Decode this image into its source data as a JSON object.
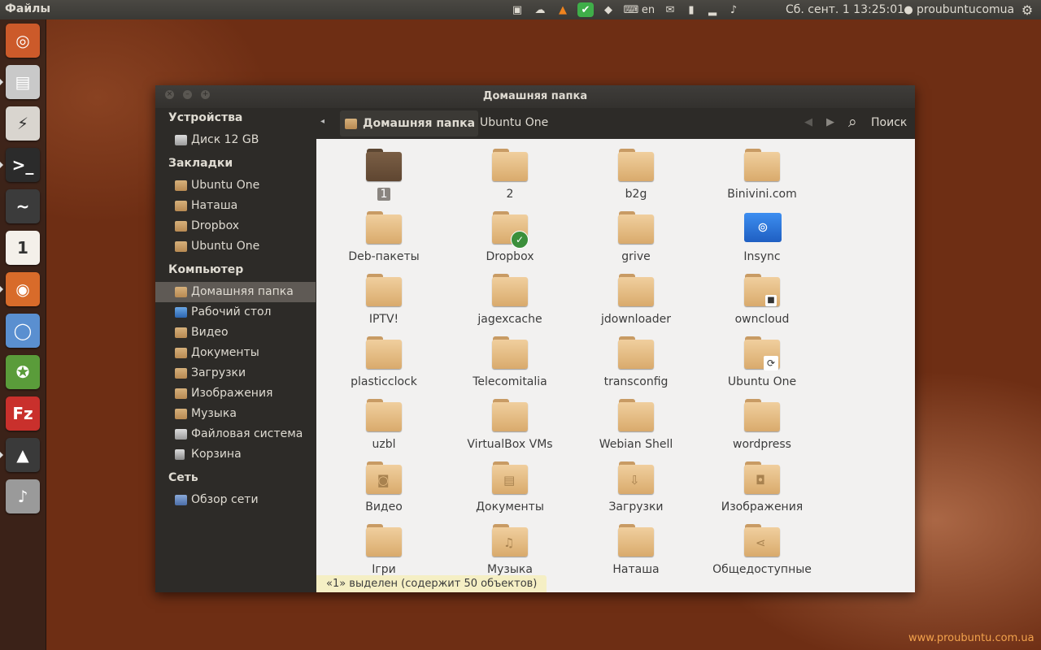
{
  "top_panel": {
    "app_title": "Файлы",
    "keyboard_layout": "en",
    "clock": "Сб. сент.  1 13:25:01",
    "user": "proubuntucomua",
    "tray_icons": [
      "dock-icon",
      "cloud-icon",
      "vlc-icon",
      "checkmark-icon",
      "dropbox-icon",
      "keyboard-icon",
      "mail-icon",
      "battery-icon",
      "signal-icon",
      "volume-icon",
      "user-icon",
      "gear-icon"
    ]
  },
  "launcher": {
    "items": [
      {
        "name": "dash-home-icon",
        "color": "#cc5a2a",
        "glyph": "◎"
      },
      {
        "name": "files-app-icon",
        "color": "#c9c9c9",
        "glyph": "▤"
      },
      {
        "name": "thunderbolt-app-icon",
        "color": "#d9d5cf",
        "glyph": "⚡"
      },
      {
        "name": "terminal-icon",
        "color": "#2b2b2b",
        "glyph": ">_"
      },
      {
        "name": "system-monitor-icon",
        "color": "#3b3b3b",
        "glyph": "~"
      },
      {
        "name": "calendar-icon",
        "color": "#f4f0ea",
        "glyph": "1"
      },
      {
        "name": "firefox-icon",
        "color": "#d86b2a",
        "glyph": "◉"
      },
      {
        "name": "chromium-icon",
        "color": "#5a8fd0",
        "glyph": "◯"
      },
      {
        "name": "ubuntu-one-icon",
        "color": "#5a9c3a",
        "glyph": "✪"
      },
      {
        "name": "filezilla-icon",
        "color": "#c9302c",
        "glyph": "Fz"
      },
      {
        "name": "vlc-icon",
        "color": "#3a3a3a",
        "glyph": "▲"
      },
      {
        "name": "music-player-icon",
        "color": "#9a9a9a",
        "glyph": "♪"
      }
    ]
  },
  "window": {
    "title": "Домашняя папка"
  },
  "sidebar": {
    "sections": [
      {
        "header": "Устройства",
        "items": [
          {
            "label": "Диск 12 GB",
            "icon": "disk-icon"
          }
        ]
      },
      {
        "header": "Закладки",
        "items": [
          {
            "label": "Ubuntu One",
            "icon": "folder-icon"
          },
          {
            "label": "Наташа",
            "icon": "folder-icon"
          },
          {
            "label": "Dropbox",
            "icon": "folder-icon"
          },
          {
            "label": "Ubuntu One",
            "icon": "folder-icon"
          }
        ]
      },
      {
        "header": "Компьютер",
        "items": [
          {
            "label": "Домашняя папка",
            "icon": "home-folder-icon",
            "selected": true
          },
          {
            "label": "Рабочий стол",
            "icon": "desktop-icon"
          },
          {
            "label": "Видео",
            "icon": "video-folder-icon"
          },
          {
            "label": "Документы",
            "icon": "documents-folder-icon"
          },
          {
            "label": "Загрузки",
            "icon": "downloads-folder-icon"
          },
          {
            "label": "Изображения",
            "icon": "pictures-folder-icon"
          },
          {
            "label": "Музыка",
            "icon": "music-folder-icon"
          },
          {
            "label": "Файловая система",
            "icon": "filesystem-icon"
          },
          {
            "label": "Корзина",
            "icon": "trash-icon"
          }
        ]
      },
      {
        "header": "Сеть",
        "items": [
          {
            "label": "Обзор сети",
            "icon": "network-icon"
          }
        ]
      }
    ]
  },
  "toolbar": {
    "crumb_current": "Домашняя папка",
    "crumb_next": "Ubuntu One",
    "search_label": "Поиск"
  },
  "content": {
    "items": [
      {
        "label": "1",
        "type": "folder-dark",
        "selected": true
      },
      {
        "label": "2",
        "type": "folder"
      },
      {
        "label": "b2g",
        "type": "folder"
      },
      {
        "label": "Binivini.com",
        "type": "folder"
      },
      {
        "label": "Deb-пакеты",
        "type": "folder"
      },
      {
        "label": "Dropbox",
        "type": "folder-check"
      },
      {
        "label": "grive",
        "type": "folder"
      },
      {
        "label": "Insync",
        "type": "insync"
      },
      {
        "label": "IPTV!",
        "type": "folder"
      },
      {
        "label": "jagexcache",
        "type": "folder"
      },
      {
        "label": "jdownloader",
        "type": "folder"
      },
      {
        "label": "owncloud",
        "type": "folder-lock"
      },
      {
        "label": "plasticclock",
        "type": "folder"
      },
      {
        "label": "Telecomitalia",
        "type": "folder"
      },
      {
        "label": "transconfig",
        "type": "folder"
      },
      {
        "label": "Ubuntu One",
        "type": "folder-sync"
      },
      {
        "label": "uzbl",
        "type": "folder"
      },
      {
        "label": "VirtualBox VMs",
        "type": "folder"
      },
      {
        "label": "Webian Shell",
        "type": "folder"
      },
      {
        "label": "wordpress",
        "type": "folder"
      },
      {
        "label": "Видео",
        "type": "folder-video"
      },
      {
        "label": "Документы",
        "type": "folder-docs"
      },
      {
        "label": "Загрузки",
        "type": "folder-down"
      },
      {
        "label": "Изображения",
        "type": "folder-pics"
      },
      {
        "label": "Ігри",
        "type": "folder"
      },
      {
        "label": "Музыка",
        "type": "folder-music"
      },
      {
        "label": "Наташа",
        "type": "folder"
      },
      {
        "label": "Общедоступные",
        "type": "folder-share"
      }
    ],
    "status": "«1» выделен (содержит 50 объектов)"
  },
  "watermark": "www.proubuntu.com.ua"
}
